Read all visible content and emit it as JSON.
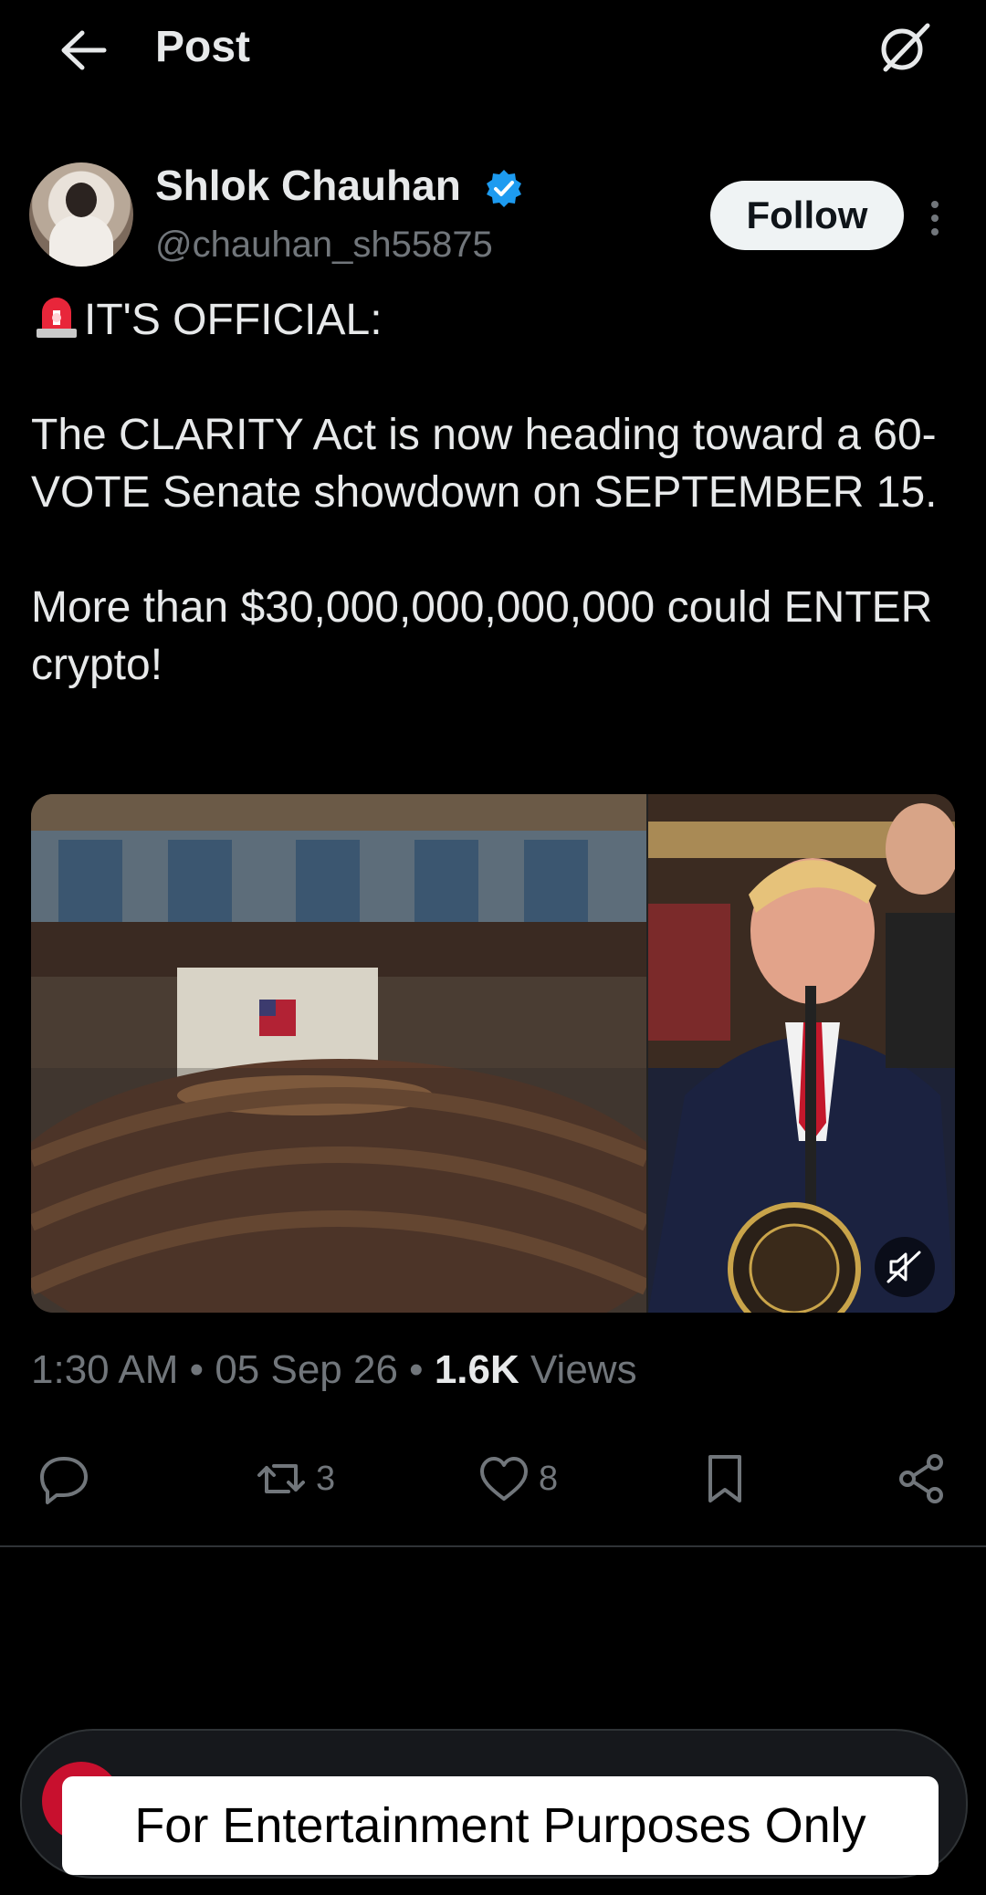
{
  "header": {
    "title": "Post",
    "back_icon": "arrow-left-icon",
    "grok_icon": "grok-icon"
  },
  "author": {
    "name": "Shlok Chauhan",
    "handle": "@chauhan_sh55875",
    "verified": true,
    "follow_label": "Follow"
  },
  "post": {
    "line1": "IT'S OFFICIAL:",
    "line2": "The CLARITY Act is now heading toward a 60-VOTE Senate showdown on SEPTEMBER 15.",
    "line3": "More than $30,000,000,000,000 could ENTER crypto!"
  },
  "meta": {
    "time": "1:30 AM",
    "date": "05 Sep 26",
    "views_count": "1.6K",
    "views_label": "Views",
    "separator": "•"
  },
  "actions": {
    "retweets": "3",
    "likes": "8"
  },
  "overlay": {
    "disclaimer": "For Entertainment Purposes Only"
  },
  "colors": {
    "verified": "#1d9bf0",
    "muted_text": "#71767b",
    "background": "#000000"
  }
}
